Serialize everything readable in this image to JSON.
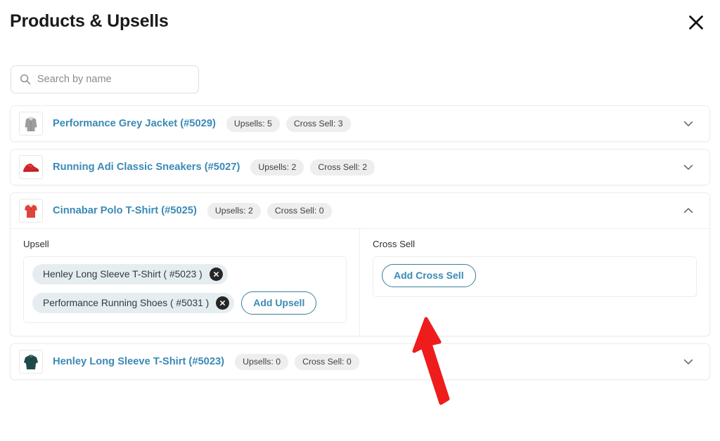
{
  "header": {
    "title": "Products & Upsells",
    "close_icon": "close-x-icon"
  },
  "search": {
    "placeholder": "Search by name",
    "value": "",
    "icon": "search-icon"
  },
  "labels": {
    "upsell_column": "Upsell",
    "cross_sell_column": "Cross Sell",
    "add_upsell": "Add Upsell",
    "add_cross_sell": "Add Cross Sell",
    "chevron_down": "chevron-down-icon",
    "chevron_up": "chevron-up-icon",
    "remove": "remove-x-icon"
  },
  "colors": {
    "link": "#3a8ab5",
    "badge_bg": "#eeeeee",
    "chip_bg": "#e6edf1",
    "outline_button_border": "#3a7f9b",
    "annotation_arrow": "#ee1c1c",
    "card_border": "#ededed"
  },
  "products": [
    {
      "name": "Performance Grey Jacket (#5029)",
      "upsells_badge": "Upsells: 5",
      "cross_sell_badge": "Cross Sell: 3",
      "expanded": false,
      "thumb": "grey-jacket-thumbnail"
    },
    {
      "name": "Running Adi Classic Sneakers (#5027)",
      "upsells_badge": "Upsells: 2",
      "cross_sell_badge": "Cross Sell: 2",
      "expanded": false,
      "thumb": "red-sneaker-thumbnail"
    },
    {
      "name": "Cinnabar Polo T-Shirt (#5025)",
      "upsells_badge": "Upsells: 2",
      "cross_sell_badge": "Cross Sell: 0",
      "expanded": true,
      "thumb": "red-polo-shirt-thumbnail",
      "upsell_items": [
        "Henley Long Sleeve T-Shirt ( #5023 )",
        "Performance Running Shoes ( #5031 )"
      ],
      "cross_sell_items": []
    },
    {
      "name": "Henley Long Sleeve T-Shirt (#5023)",
      "upsells_badge": "Upsells: 0",
      "cross_sell_badge": "Cross Sell: 0",
      "expanded": false,
      "thumb": "dark-teal-henley-thumbnail"
    }
  ],
  "annotation": {
    "type": "arrow",
    "points_to": "add-cross-sell-button"
  }
}
